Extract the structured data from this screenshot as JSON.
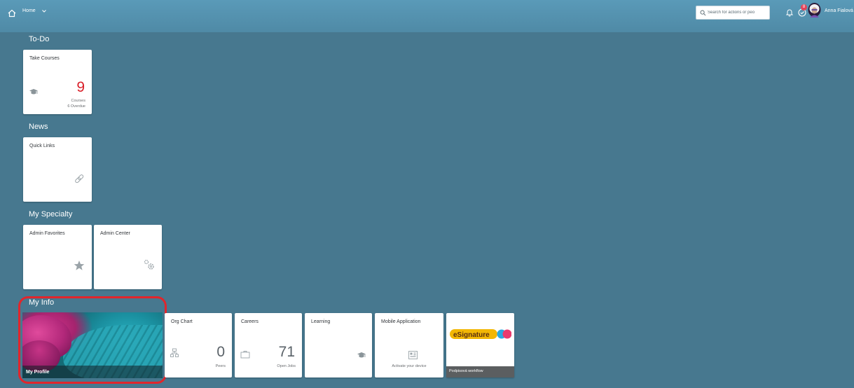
{
  "header": {
    "home_label": "Home",
    "search_placeholder": "Search for actions or peo",
    "notification_count": "8",
    "user_name": "Anna Fialová",
    "icons": [
      "home-icon",
      "chevron-down-icon",
      "search-icon",
      "bell-icon",
      "notifications-icon",
      "avatar"
    ]
  },
  "sections": {
    "todo": "To-Do",
    "news": "News",
    "specialty": "My Specialty",
    "myinfo": "My Info"
  },
  "tiles": {
    "take_courses": {
      "title": "Take Courses",
      "value": "9",
      "unit": "Courses",
      "subunit": "6 Overdue",
      "icon": "graduation-cap-icon"
    },
    "quick_links": {
      "title": "Quick Links",
      "icon": "link-icon"
    },
    "admin_favorites": {
      "title": "Admin Favorites",
      "icon": "star-icon"
    },
    "admin_center": {
      "title": "Admin Center",
      "icon": "gears-icon"
    },
    "my_profile": {
      "title": "My Profile"
    },
    "org_chart": {
      "title": "Org Chart",
      "value": "0",
      "unit": "Peers",
      "icon": "org-chart-icon"
    },
    "careers": {
      "title": "Careers",
      "value": "71",
      "unit": "Open Jobs",
      "icon": "briefcase-icon"
    },
    "learning": {
      "title": "Learning",
      "icon": "graduation-cap-icon"
    },
    "mobile_application": {
      "title": "Mobile Application",
      "subtitle": "Activate your device",
      "icon": "qr-code-icon"
    },
    "esignature": {
      "logo_text": "eSignature",
      "footer": "Podpisová workflow"
    }
  },
  "colors": {
    "background": "#47788f",
    "shellbar": "#5a9ab8",
    "accent_red": "#e0262c",
    "overdue_red": "#d9202a",
    "esig_yellow": "#f2b705"
  }
}
